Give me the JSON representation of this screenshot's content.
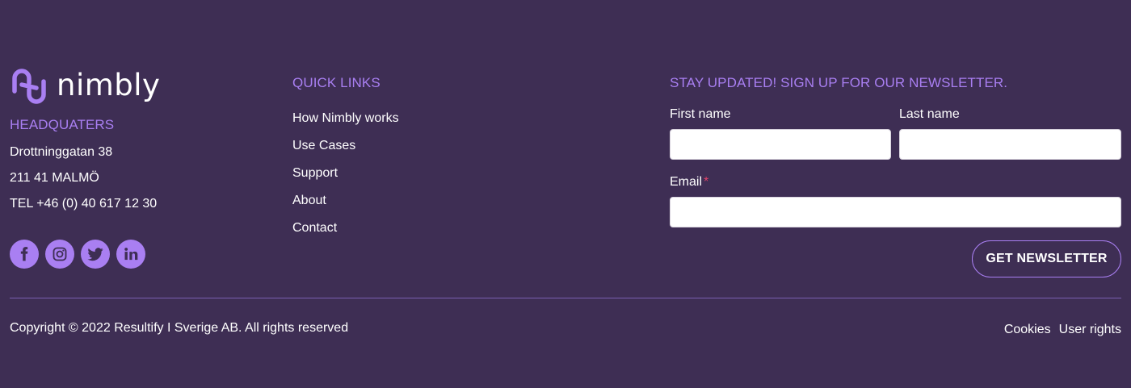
{
  "brand": {
    "name": "nimbly",
    "accent": "#a97ff2",
    "background": "#3e2e54"
  },
  "hq": {
    "title": "HEADQUATERS",
    "street": "Drottninggatan 38",
    "city": "211 41 MALMÖ",
    "phone": "TEL +46 (0) 40 617 12 30"
  },
  "social": [
    {
      "icon": "facebook-icon"
    },
    {
      "icon": "instagram-icon"
    },
    {
      "icon": "twitter-icon"
    },
    {
      "icon": "linkedin-icon"
    }
  ],
  "quick_links": {
    "title": "QUICK LINKS",
    "items": [
      "How Nimbly works",
      "Use Cases",
      "Support",
      "About",
      "Contact"
    ]
  },
  "newsletter": {
    "title": "STAY UPDATED! SIGN UP FOR OUR NEWSLETTER.",
    "first_name_label": "First name",
    "first_name_value": "",
    "last_name_label": "Last name",
    "last_name_value": "",
    "email_label": "Email",
    "email_required_mark": "*",
    "email_value": "",
    "submit_label": "GET NEWSLETTER"
  },
  "footer": {
    "copyright": "Copyright © 2022 Resultify I Sverige AB. All rights reserved",
    "links": [
      "Cookies",
      "User rights"
    ]
  }
}
